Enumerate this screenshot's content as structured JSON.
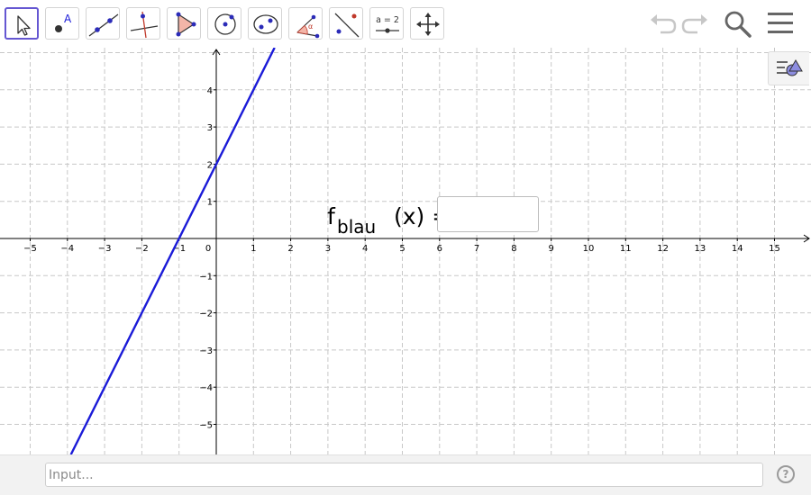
{
  "toolbar": {
    "tools": [
      {
        "name": "move-tool-button",
        "icon": "arrow-pointer-icon",
        "active": true
      },
      {
        "name": "point-tool-button",
        "icon": "point-icon",
        "label": "A"
      },
      {
        "name": "line-tool-button",
        "icon": "line-through-points-icon"
      },
      {
        "name": "perpendicular-line-tool-button",
        "icon": "perpendicular-line-icon"
      },
      {
        "name": "polygon-tool-button",
        "icon": "polygon-icon"
      },
      {
        "name": "circle-tool-button",
        "icon": "circle-with-center-icon"
      },
      {
        "name": "conic-tool-button",
        "icon": "ellipse-icon"
      },
      {
        "name": "angle-tool-button",
        "icon": "angle-icon",
        "label": "α"
      },
      {
        "name": "reflect-tool-button",
        "icon": "reflect-about-line-icon"
      },
      {
        "name": "slider-tool-button",
        "icon": "slider-icon",
        "label": "a = 2"
      },
      {
        "name": "move-graphics-view-tool-button",
        "icon": "move-arrows-icon"
      }
    ],
    "right": [
      {
        "name": "undo-button",
        "icon": "undo-icon"
      },
      {
        "name": "redo-button",
        "icon": "redo-icon"
      },
      {
        "name": "search-button",
        "icon": "search-icon"
      },
      {
        "name": "main-menu-button",
        "icon": "hamburger-menu-icon"
      }
    ]
  },
  "graph": {
    "x_ticks": [
      "−5",
      "−4",
      "−3",
      "−2",
      "−1",
      "0",
      "1",
      "2",
      "3",
      "4",
      "5",
      "6",
      "7",
      "8",
      "9",
      "10",
      "11",
      "12",
      "13",
      "14",
      "15"
    ],
    "y_ticks": [
      "4",
      "3",
      "2",
      "1",
      "−1",
      "−2",
      "−3",
      "−4",
      "−5"
    ],
    "x_range": [
      -5.8,
      15.9
    ],
    "y_range": [
      -5.9,
      5.1
    ],
    "grid": true,
    "line": {
      "slope": 2,
      "intercept": 2,
      "color": "#1a1ad8"
    }
  },
  "formula": {
    "f": "f",
    "subscript": "blau",
    "rest": " (x) =",
    "answer_value": ""
  },
  "sidebar_toggle": {
    "icon": "algebra-view-toggle-icon"
  },
  "input_bar": {
    "placeholder": "Input...",
    "value": "",
    "help_label": "?"
  }
}
